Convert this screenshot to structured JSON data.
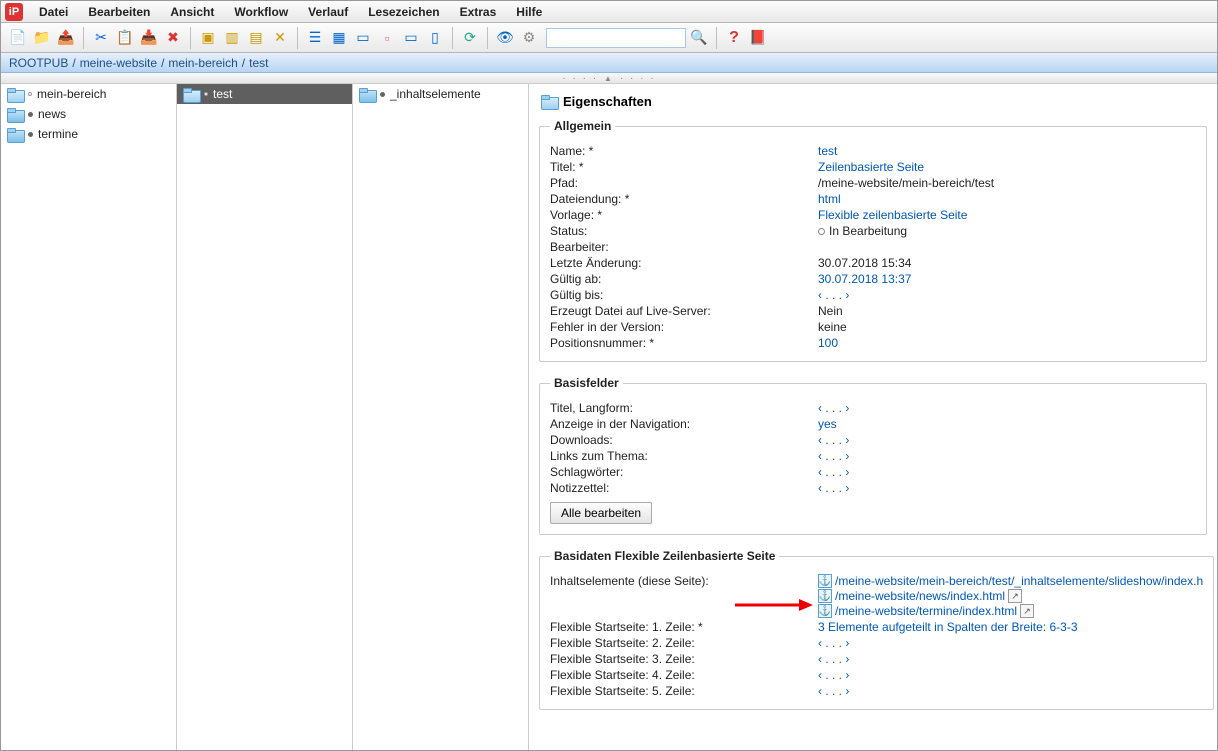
{
  "menu": {
    "items": [
      "Datei",
      "Bearbeiten",
      "Ansicht",
      "Workflow",
      "Verlauf",
      "Lesezeichen",
      "Extras",
      "Hilfe"
    ]
  },
  "toolbar": {
    "buttons": [
      {
        "name": "new-file-icon",
        "glyph": "📄",
        "color": "#d9a400"
      },
      {
        "name": "new-folder-icon",
        "glyph": "📁",
        "color": "#2a8"
      },
      {
        "name": "export-icon",
        "glyph": "📤",
        "color": "#d77"
      },
      {
        "sep": true
      },
      {
        "name": "cut-icon",
        "glyph": "✂",
        "color": "#06c"
      },
      {
        "name": "copy-icon",
        "glyph": "📋",
        "color": "#e6b800"
      },
      {
        "name": "paste-icon",
        "glyph": "📥",
        "color": "#e6b800"
      },
      {
        "name": "delete-icon",
        "glyph": "✖",
        "color": "#d33"
      },
      {
        "sep": true
      },
      {
        "name": "action1-icon",
        "glyph": "▣",
        "color": "#c90"
      },
      {
        "name": "action2-icon",
        "glyph": "▥",
        "color": "#c90"
      },
      {
        "name": "action3-icon",
        "glyph": "▤",
        "color": "#c90"
      },
      {
        "name": "action4-icon",
        "glyph": "✕",
        "color": "#c90"
      },
      {
        "sep": true
      },
      {
        "name": "view-list-icon",
        "glyph": "☰",
        "color": "#06c"
      },
      {
        "name": "view-grid-icon",
        "glyph": "▦",
        "color": "#06c"
      },
      {
        "name": "view-detail-icon",
        "glyph": "▭",
        "color": "#06c"
      },
      {
        "name": "view-tiles-icon",
        "glyph": "▫",
        "color": "#e67"
      },
      {
        "name": "view-cards-icon",
        "glyph": "▭",
        "color": "#06c"
      },
      {
        "name": "view-col-icon",
        "glyph": "▯",
        "color": "#06c"
      },
      {
        "sep": true
      },
      {
        "name": "refresh-icon",
        "glyph": "⟳",
        "color": "#2a8"
      },
      {
        "sep": true
      },
      {
        "name": "preview-icon",
        "glyph": "👁",
        "color": "#06c"
      },
      {
        "name": "settings-icon",
        "glyph": "⚙",
        "color": "#888"
      }
    ],
    "search_placeholder": "",
    "search_icon": "🔍",
    "help_icon": "?",
    "book_icon": "📕"
  },
  "breadcrumb": [
    "ROOTPUB",
    "meine-website",
    "mein-bereich",
    "test"
  ],
  "columns": {
    "col1": [
      {
        "label": "mein-bereich",
        "selected": false,
        "open": true
      },
      {
        "label": "news",
        "selected": false,
        "open": false
      },
      {
        "label": "termine",
        "selected": false,
        "open": false
      }
    ],
    "col2": [
      {
        "label": "test",
        "selected": true,
        "open": true
      }
    ],
    "col3": [
      {
        "label": "_inhaltselemente",
        "selected": false,
        "open": false
      }
    ]
  },
  "props": {
    "heading": "Eigenschaften",
    "groups": {
      "allgemein": {
        "legend": "Allgemein",
        "rows": [
          {
            "k": "Name: *",
            "v": "test",
            "link": true
          },
          {
            "k": "Titel: *",
            "v": "Zeilenbasierte Seite",
            "link": true
          },
          {
            "k": "Pfad:",
            "v": "/meine-website/mein-bereich/test",
            "link": false
          },
          {
            "k": "Dateiendung: *",
            "v": "html",
            "link": true
          },
          {
            "k": "Vorlage: *",
            "v": "Flexible zeilenbasierte Seite",
            "link": true
          },
          {
            "k": "Status:",
            "v": "In Bearbeitung",
            "link": false,
            "status": true
          },
          {
            "k": "Bearbeiter:",
            "v": "",
            "link": false
          },
          {
            "k": "Letzte Änderung:",
            "v": "30.07.2018 15:34",
            "link": false
          },
          {
            "k": "Gültig ab:",
            "v": "30.07.2018 13:37",
            "link": true
          },
          {
            "k": "Gültig bis:",
            "v": "‹ . . . ›",
            "link": true,
            "dim": true
          },
          {
            "k": "Erzeugt Datei auf Live-Server:",
            "v": "Nein",
            "link": false
          },
          {
            "k": "Fehler in der Version:",
            "v": "keine",
            "link": false
          },
          {
            "k": "Positionsnummer: *",
            "v": "100",
            "link": true
          }
        ]
      },
      "basisfelder": {
        "legend": "Basisfelder",
        "rows": [
          {
            "k": "Titel, Langform:",
            "v": "‹ . . . ›",
            "link": true,
            "dim": true
          },
          {
            "k": "Anzeige in der Navigation:",
            "v": "yes",
            "link": true
          },
          {
            "k": "Downloads:",
            "v": "‹ . . . ›",
            "link": true,
            "dim": true
          },
          {
            "k": "Links zum Thema:",
            "v": "‹ . . . ›",
            "link": true,
            "dim": true
          },
          {
            "k": "Schlagwörter:",
            "v": "‹ . . . ›",
            "link": true,
            "dim": true
          },
          {
            "k": "Notizzettel:",
            "v": "‹ . . . ›",
            "link": true,
            "dim": true
          }
        ],
        "button": "Alle bearbeiten"
      },
      "basidaten": {
        "legend": "Basidaten Flexible Zeilenbasierte Seite",
        "inhalts_label": "Inhaltselemente (diese Seite):",
        "links": [
          {
            "path": "/meine-website/mein-bereich/test/_inhaltselemente/slideshow/index.h",
            "ext": false
          },
          {
            "path": "/meine-website/news/index.html",
            "ext": true
          },
          {
            "path": "/meine-website/termine/index.html",
            "ext": true
          }
        ],
        "rows": [
          {
            "k": "Flexible Startseite: 1. Zeile: *",
            "v": "3 Elemente aufgeteilt in Spalten der Breite: 6-3-3",
            "link": true
          },
          {
            "k": "Flexible Startseite: 2. Zeile:",
            "v": "‹ . . . ›",
            "link": true,
            "dim": true
          },
          {
            "k": "Flexible Startseite: 3. Zeile:",
            "v": "‹ . . . ›",
            "link": true,
            "dim": true
          },
          {
            "k": "Flexible Startseite: 4. Zeile:",
            "v": "‹ . . . ›",
            "link": true,
            "dim": true
          },
          {
            "k": "Flexible Startseite: 5. Zeile:",
            "v": "‹ . . . ›",
            "link": true,
            "dim": true
          }
        ]
      }
    }
  }
}
